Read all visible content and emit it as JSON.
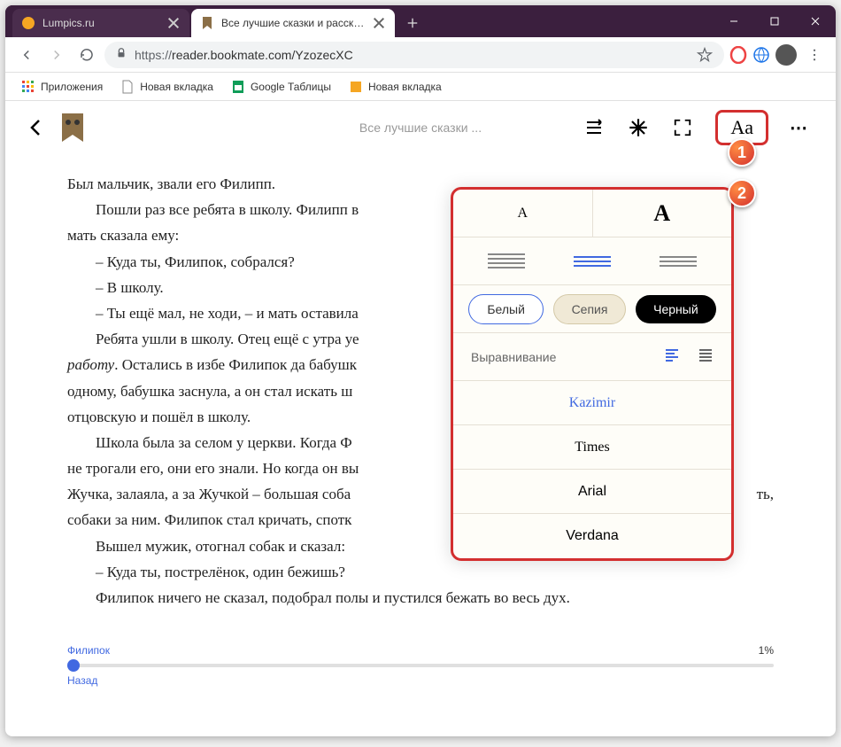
{
  "window": {
    "tabs": [
      {
        "title": "Lumpics.ru",
        "active": false
      },
      {
        "title": "Все лучшие сказки и рассказы",
        "active": true
      }
    ]
  },
  "address_bar": {
    "protocol": "https://",
    "url": "reader.bookmate.com/YzozecXC"
  },
  "bookmarks": [
    {
      "label": "Приложения"
    },
    {
      "label": "Новая вкладка"
    },
    {
      "label": "Google Таблицы"
    },
    {
      "label": "Новая вкладка"
    }
  ],
  "reader": {
    "book_title": "Все лучшие сказки ...",
    "aa_label": "Aa"
  },
  "content": {
    "p1": "Был мальчик, звали его Филипп.",
    "p2": "Пошли раз все ребята в школу. Филипп в",
    "p3": "мать сказала ему:",
    "p4": "– Куда ты, Филипок, собрался?",
    "p5": "– В школу.",
    "p6": "– Ты ещё мал, не ходи, – и мать оставила",
    "p7a": "Ребята ушли в школу. Отец ещё с утра уе",
    "p7b_italic": "работу",
    "p7c": ". Остались в избе Филипок да бабушк",
    "p8": "одному, бабушка заснула, а он стал искать ш",
    "p9": "отцовскую и пошёл в школу.",
    "p10": "Школа была за селом у церкви. Когда Ф",
    "p11": "не трогали его, они его знали. Но когда он вы",
    "p12": "Жучка, залаяла, а за Жучкой – большая соба",
    "p12b": "ть,",
    "p13": "собаки за ним. Филипок стал кричать, спотк",
    "p14": "Вышел мужик, отогнал собак и сказал:",
    "p15": "– Куда ты, пострелёнок, один бежишь?",
    "p16": "Филипок ничего не сказал, подобрал полы и пустился бежать во весь дух."
  },
  "progress": {
    "chapter": "Филипок",
    "percent": "1%",
    "back": "Назад"
  },
  "settings": {
    "size_small": "A",
    "size_large": "A",
    "theme_white": "Белый",
    "theme_sepia": "Сепия",
    "theme_black": "Черный",
    "align_label": "Выравнивание",
    "fonts": {
      "kazimir": "Kazimir",
      "times": "Times",
      "arial": "Arial",
      "verdana": "Verdana"
    }
  },
  "annotations": {
    "one": "1",
    "two": "2"
  }
}
